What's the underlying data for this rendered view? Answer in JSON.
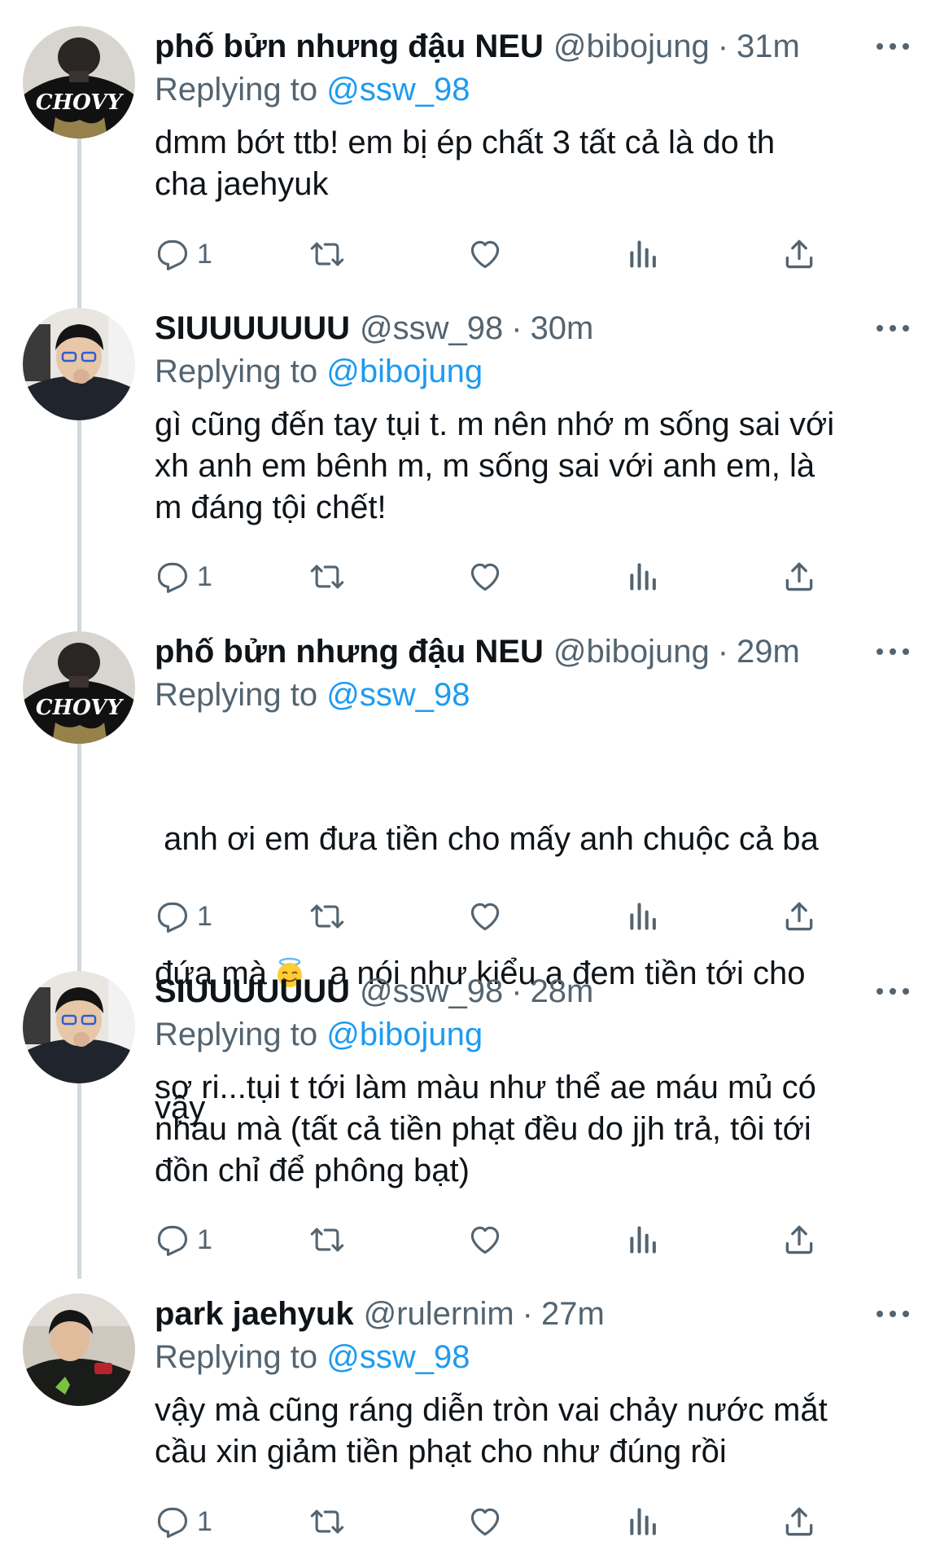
{
  "colors": {
    "accent": "#1d9bf0",
    "muted": "#536471",
    "text": "#0f1419",
    "thread_line": "#cfd9de"
  },
  "tweets": [
    {
      "name": "phố bửn nhưng đậu NEU",
      "handle": "@bibojung",
      "time": "31m",
      "replying_label": "Replying to",
      "replying_to": "@ssw_98",
      "text": "dmm bớt ttb! em bị ép chất 3 tất cả là do th\ncha jaehyuk",
      "reply_count": "1"
    },
    {
      "name": "SIUUUUUUU",
      "handle": "@ssw_98",
      "time": "30m",
      "replying_label": "Replying to",
      "replying_to": "@bibojung",
      "text": "gì cũng đến tay tụi t. m nên nhớ m sống sai với\nxh anh em bênh m, m sống sai với anh em, là\nm đáng tội chết!",
      "reply_count": "1"
    },
    {
      "name": "phố bửn nhưng đậu NEU",
      "handle": "@bibojung",
      "time": "29m",
      "replying_label": "Replying to",
      "replying_to": "@ssw_98",
      "text_line1": " anh ơi em đưa tiền cho mấy anh chuộc cả ba",
      "text_line2a": "đứa mà",
      "emoji": "smiling-face-with-halo-emoji",
      "text_line2b": " a nói như kiểu a đem tiền tới cho",
      "text_line3": "vậy",
      "reply_count": "1"
    },
    {
      "name": "SIUUUUUUU",
      "handle": "@ssw_98",
      "time": "28m",
      "replying_label": "Replying to",
      "replying_to": "@bibojung",
      "text": "sơ ri...tụi t tới làm màu như thể ae máu mủ có\nnhau mà (tất cả tiền phạt đều do jjh trả, tôi tới\nđồn chỉ để phông bạt)",
      "reply_count": "1"
    },
    {
      "name": "park jaehyuk",
      "handle": "@rulernim",
      "time": "27m",
      "replying_label": "Replying to",
      "replying_to": "@ssw_98",
      "text": "vậy mà cũng ráng diễn tròn vai chảy nước mắt\ncầu xin giảm tiền phạt cho như đúng rồi",
      "reply_count": "1"
    }
  ],
  "icons": {
    "reply": "reply-bubble-icon",
    "retweet": "retweet-icon",
    "like": "heart-icon",
    "analytics": "analytics-bars-icon",
    "share": "share-upload-icon",
    "more": "more-dots-icon"
  }
}
